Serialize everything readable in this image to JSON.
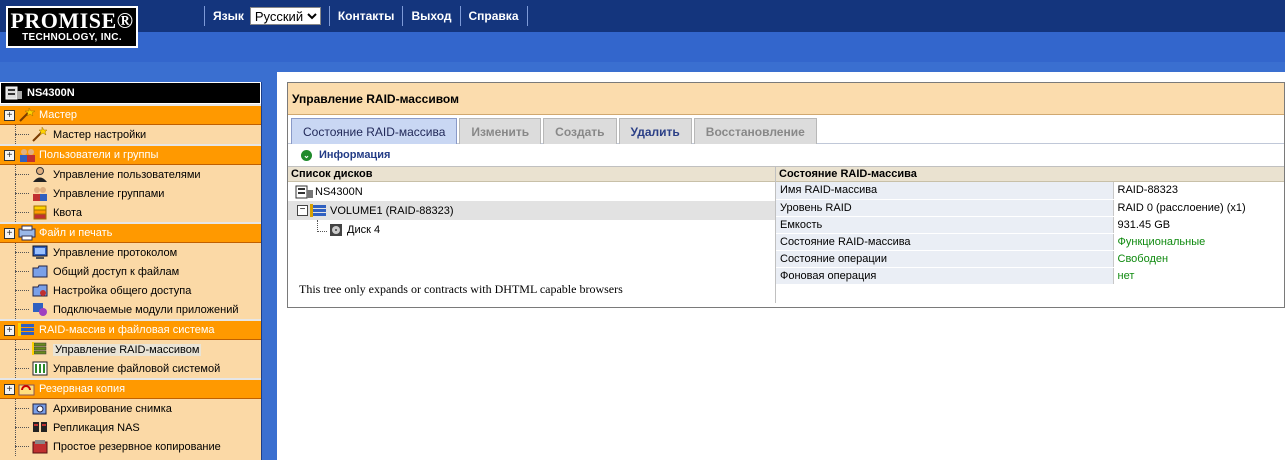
{
  "header": {
    "logo_line1": "PROMISE®",
    "logo_line2": "TECHNOLOGY, INC.",
    "language_label": "Язык",
    "language_selected": "Русский",
    "nav": [
      "Контакты",
      "Выход",
      "Справка"
    ]
  },
  "sidebar": {
    "device": "NS4300N",
    "groups": [
      {
        "label": "Мастер",
        "icon": "wizard-icon",
        "items": [
          {
            "label": "Мастер настройки",
            "icon": "setup-wizard-icon"
          }
        ]
      },
      {
        "label": "Пользователи и группы",
        "icon": "users-groups-icon",
        "items": [
          {
            "label": "Управление пользователями",
            "icon": "user-icon"
          },
          {
            "label": "Управление группами",
            "icon": "group-icon"
          },
          {
            "label": "Квота",
            "icon": "quota-icon"
          }
        ]
      },
      {
        "label": "Файл и печать",
        "icon": "file-print-icon",
        "items": [
          {
            "label": "Управление протоколом",
            "icon": "protocol-icon"
          },
          {
            "label": "Общий доступ к файлам",
            "icon": "folder-share-icon"
          },
          {
            "label": "Настройка общего доступа",
            "icon": "share-settings-icon"
          },
          {
            "label": "Подключаемые модули приложений",
            "icon": "plugin-icon"
          }
        ]
      },
      {
        "label": "RAID-массив и файловая система",
        "icon": "raid-icon",
        "items": [
          {
            "label": "Управление RAID-массивом",
            "icon": "raid-manage-icon",
            "active": true
          },
          {
            "label": "Управление файловой системой",
            "icon": "filesystem-icon"
          }
        ]
      },
      {
        "label": "Резервная копия",
        "icon": "backup-icon",
        "items": [
          {
            "label": "Архивирование снимка",
            "icon": "snapshot-icon"
          },
          {
            "label": "Репликация NAS",
            "icon": "replication-icon"
          },
          {
            "label": "Простое резервное копирование",
            "icon": "simple-backup-icon"
          }
        ]
      }
    ]
  },
  "panel": {
    "title": "Управление RAID-массивом",
    "tabs": [
      {
        "label": "Состояние RAID-массива",
        "state": "active"
      },
      {
        "label": "Изменить",
        "state": "disabled"
      },
      {
        "label": "Создать",
        "state": "disabled"
      },
      {
        "label": "Удалить",
        "state": "enabled"
      },
      {
        "label": "Восстановление",
        "state": "disabled"
      }
    ],
    "info_label": "Информация",
    "disk_list_header": "Список дисков",
    "tree": {
      "root": "NS4300N",
      "volume": "VOLUME1 (RAID-88323)",
      "disk": "Диск 4"
    },
    "tree_note": "This tree only expands or contracts with DHTML capable browsers",
    "status_header": "Состояние RAID-массива",
    "properties": [
      {
        "key": "Имя RAID-массива",
        "value": "RAID-88323",
        "green": false
      },
      {
        "key": "Уровень RAID",
        "value": "RAID 0 (расслоение) (x1)",
        "green": false
      },
      {
        "key": "Емкость",
        "value": "931.45 GB",
        "green": false
      },
      {
        "key": "Состояние RAID-массива",
        "value": "Функциональные",
        "green": true
      },
      {
        "key": "Состояние операции",
        "value": "Свободен",
        "green": true
      },
      {
        "key": "Фоновая операция",
        "value": "нет",
        "green": true
      }
    ]
  },
  "colors": {
    "accent_orange": "#ff9900",
    "sidebar_bg": "#fbd9a6",
    "top_blue": "#3366cc",
    "status_green": "#0f8a0f"
  }
}
